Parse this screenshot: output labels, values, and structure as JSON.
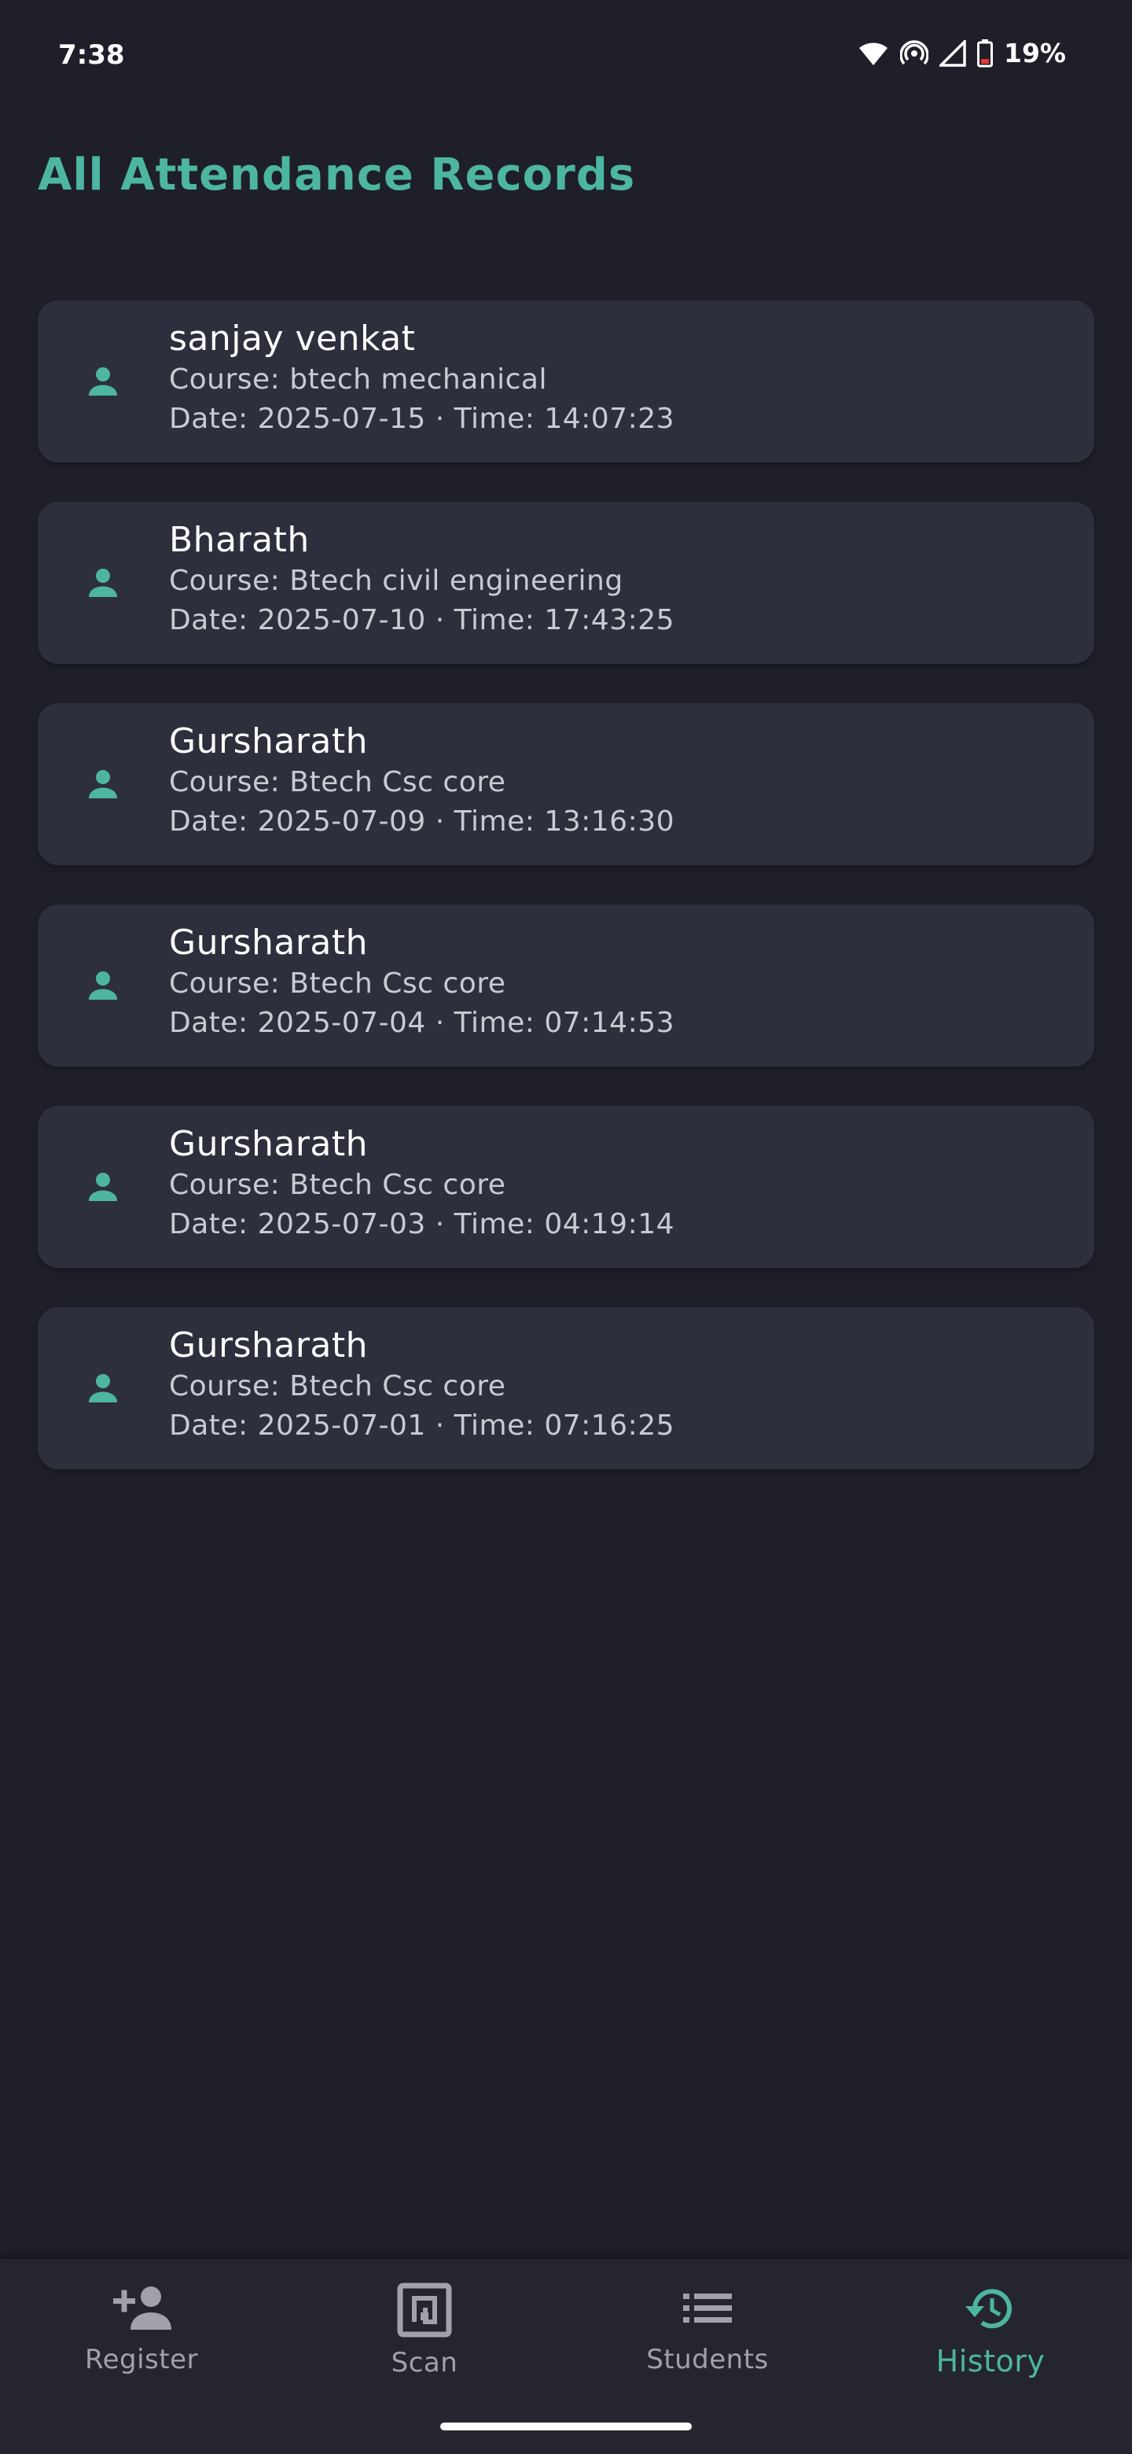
{
  "status_bar": {
    "time": "7:38",
    "battery": "19%"
  },
  "page": {
    "title": "All Attendance Records"
  },
  "records": [
    {
      "name": "sanjay venkat",
      "course": "Course: btech mechanical",
      "datetime": "Date: 2025-07-15 · Time: 14:07:23"
    },
    {
      "name": "Bharath",
      "course": "Course: Btech civil engineering",
      "datetime": "Date: 2025-07-10 · Time: 17:43:25"
    },
    {
      "name": "Gursharath",
      "course": "Course: Btech Csc core",
      "datetime": "Date: 2025-07-09 · Time: 13:16:30"
    },
    {
      "name": "Gursharath",
      "course": "Course: Btech Csc core",
      "datetime": "Date: 2025-07-04 · Time: 07:14:53"
    },
    {
      "name": "Gursharath",
      "course": "Course: Btech Csc core",
      "datetime": "Date: 2025-07-03 · Time: 04:19:14"
    },
    {
      "name": "Gursharath",
      "course": "Course: Btech Csc core",
      "datetime": "Date: 2025-07-01 · Time: 07:16:25"
    }
  ],
  "nav": {
    "items": [
      {
        "label": "Register",
        "icon": "person-add-icon"
      },
      {
        "label": "Scan",
        "icon": "nfc-scan-icon"
      },
      {
        "label": "Students",
        "icon": "list-icon"
      },
      {
        "label": "History",
        "icon": "history-icon",
        "active": true
      }
    ]
  },
  "colors": {
    "accent": "#4db6a0",
    "background": "#1e1f29",
    "card": "#2e2f3d",
    "nav_background": "#24252f",
    "inactive": "#a0a1aa"
  }
}
